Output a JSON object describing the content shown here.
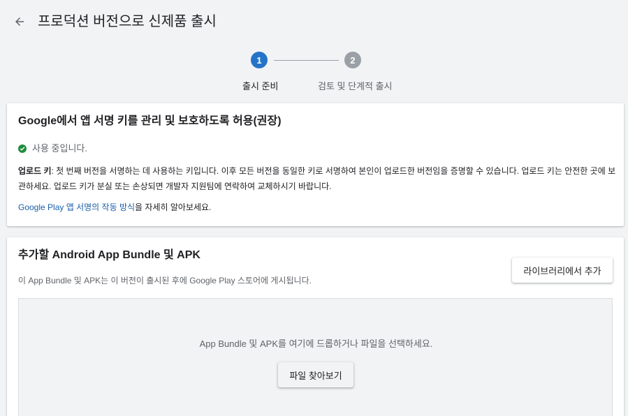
{
  "header": {
    "title": "프로덕션 버전으로 신제품 출시",
    "back_icon": "arrow-back-icon"
  },
  "stepper": {
    "steps": [
      {
        "number": "1",
        "label": "출시 준비",
        "state": "active"
      },
      {
        "number": "2",
        "label": "검토 및 단계적 출시",
        "state": "inactive"
      }
    ],
    "active_color": "#2573c9",
    "inactive_color": "#9aa0a6"
  },
  "app_signing": {
    "title": "Google에서 앱 서명 키를 관리 및 보호하도록 허용(권장)",
    "status_icon": "check-circle-icon",
    "status_color": "#1e8e3e",
    "status_text": "사용 중입니다.",
    "upload_key_label": "업로드 키",
    "upload_key_desc": ": 첫 번째 버전을 서명하는 데 사용하는 키입니다. 이후 모든 버전을 동일한 키로 서명하여 본인이 업로드한 버전임을 증명할 수 있습니다. 업로드 키는 안전한 곳에 보관하세요. 업로드 키가 분실 또는 손상되면 개발자 지원팀에 연락하여 교체하시기 바랍니다.",
    "learn_link": "Google Play 앱 서명의 작동 방식",
    "learn_suffix": "을 자세히 알아보세요."
  },
  "bundles": {
    "title": "추가할 Android App Bundle 및 APK",
    "subtitle": "이 App Bundle 및 APK는 이 버전이 출시된 후에 Google Play 스토어에 게시됩니다.",
    "library_button": "라이브러리에서 추가",
    "drop_text": "App Bundle 및 APK를 여기에 드롭하거나 파일을 선택하세요.",
    "browse_button": "파일 찾아보기"
  }
}
